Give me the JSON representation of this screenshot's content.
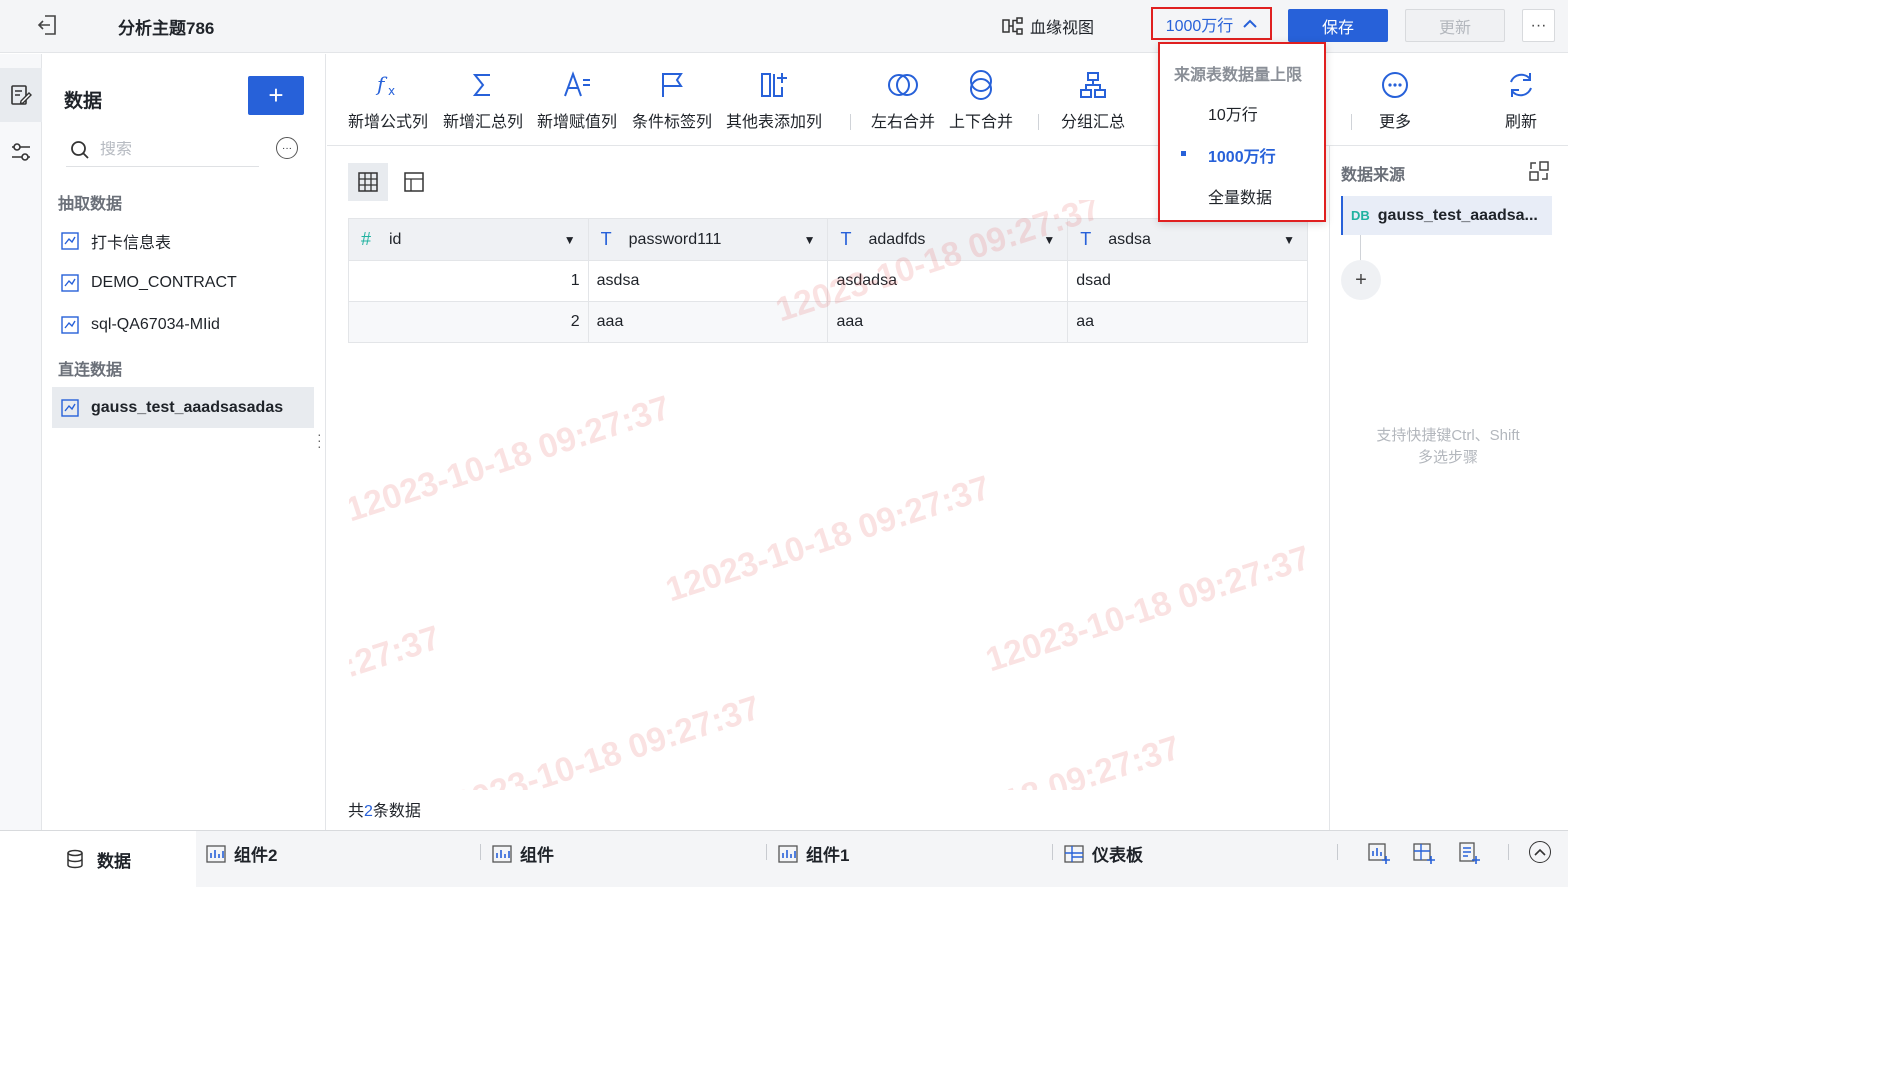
{
  "header": {
    "title": "分析主题786",
    "lineage_label": "血缘视图",
    "limit_label": "1000万行",
    "save_label": "保存",
    "update_label": "更新",
    "more_label": "···"
  },
  "data_panel": {
    "heading": "数据",
    "add_label": "+",
    "search_placeholder": "搜索",
    "extract_section": "抽取数据",
    "extract_items": [
      "打卡信息表",
      "DEMO_CONTRACT",
      "sql-QA67034-MIid"
    ],
    "direct_section": "直连数据",
    "direct_items": [
      "gauss_test_aaadsasadas"
    ]
  },
  "toolbar": {
    "tools": [
      {
        "label": "新增公式列",
        "icon": "formula-icon"
      },
      {
        "label": "新增汇总列",
        "icon": "sum-icon"
      },
      {
        "label": "新增赋值列",
        "icon": "assign-icon"
      },
      {
        "label": "条件标签列",
        "icon": "flag-icon"
      },
      {
        "label": "其他表添加列",
        "icon": "add-column-icon"
      },
      {
        "label": "左右合并",
        "icon": "merge-horizontal-icon"
      },
      {
        "label": "上下合并",
        "icon": "merge-vertical-icon"
      },
      {
        "label": "分组汇总",
        "icon": "group-icon"
      },
      {
        "label": "更多",
        "icon": "more-icon"
      },
      {
        "label": "刷新",
        "icon": "refresh-icon"
      }
    ]
  },
  "table": {
    "columns": [
      {
        "name": "id",
        "type": "number"
      },
      {
        "name": "password111",
        "type": "text"
      },
      {
        "name": "adadfds",
        "type": "text"
      },
      {
        "name": "asdsa",
        "type": "text"
      }
    ],
    "rows": [
      [
        "1",
        "asdsa",
        "asdadsa",
        "dsad"
      ],
      [
        "2",
        "aaa",
        "aaa",
        "aa"
      ]
    ]
  },
  "row_count": {
    "prefix": "共",
    "count": "2",
    "suffix": "条数据"
  },
  "watermark_text": "12023-10-18 09:27:37",
  "right_panel": {
    "heading": "数据来源",
    "source_badge": "DB",
    "source_name": "gauss_test_aaadsa...",
    "hint_line1": "支持快捷键Ctrl、Shift",
    "hint_line2": "多选步骤"
  },
  "limit_menu": {
    "title": "来源表数据量上限",
    "options": [
      "10万行",
      "1000万行",
      "全量数据"
    ],
    "selected": "1000万行"
  },
  "bottom_tabs": {
    "data_label": "数据",
    "tabs": [
      "组件2",
      "组件",
      "组件1",
      "仪表板"
    ]
  },
  "colors": {
    "accent": "#2761d9",
    "highlight_border": "#e02020",
    "number_type": "#20b2a0"
  }
}
